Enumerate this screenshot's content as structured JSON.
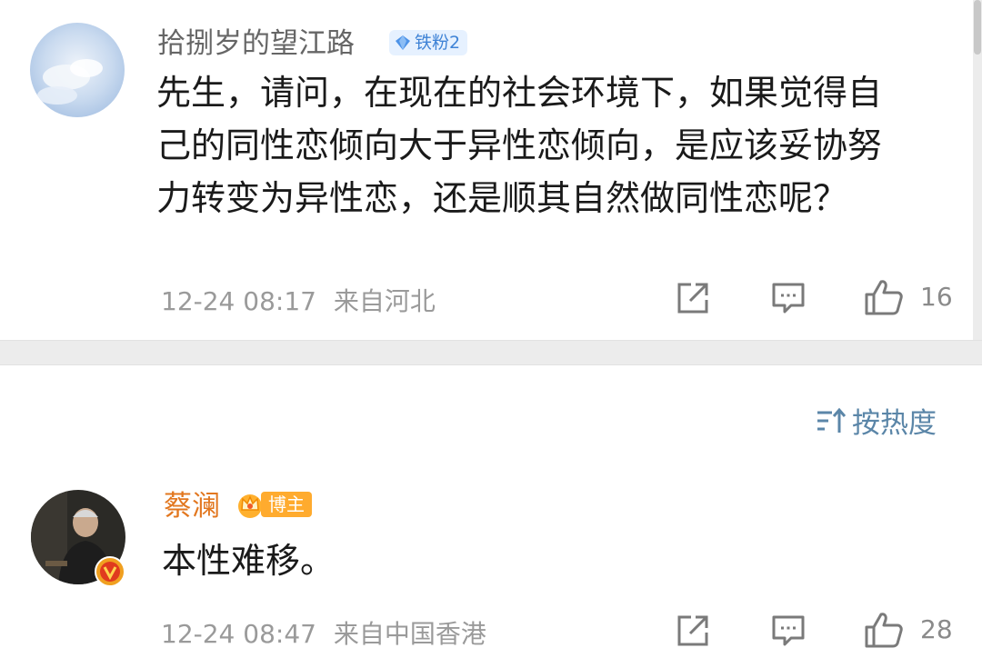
{
  "comment": {
    "username": "拾捌岁的望江路",
    "fan_badge": "铁粉2",
    "text_lines": [
      "先生，请问，在现在的社会环境下，如果觉得自",
      "己的同性恋倾向大于异性恋倾向，是应该妥协努",
      "力转变为异性恋，还是顺其自然做同性恋呢？"
    ],
    "timestamp": "12-24 08:17",
    "location": "来自河北",
    "like_count": "16"
  },
  "sort": {
    "label": "按热度"
  },
  "reply": {
    "username": "蔡澜",
    "host_badge": "博主",
    "text": "本性难移。",
    "timestamp": "12-24 08:47",
    "location": "来自中国香港",
    "like_count": "28"
  },
  "colors": {
    "username_gray": "#666666",
    "host_name_orange": "#e2771f",
    "meta_gray": "#9a9a9a",
    "fan_badge_bg": "#e6f1ff",
    "fan_badge_text": "#3f83d6",
    "host_badge_bg": "#ffab2e",
    "sort_blue": "#5b86a8"
  },
  "icons": {
    "share": "share-icon",
    "comment": "comment-icon",
    "like": "thumbs-up-icon",
    "sort": "sort-icon",
    "crown": "crown-icon",
    "verified": "verified-v-icon",
    "diamond": "diamond-icon"
  }
}
